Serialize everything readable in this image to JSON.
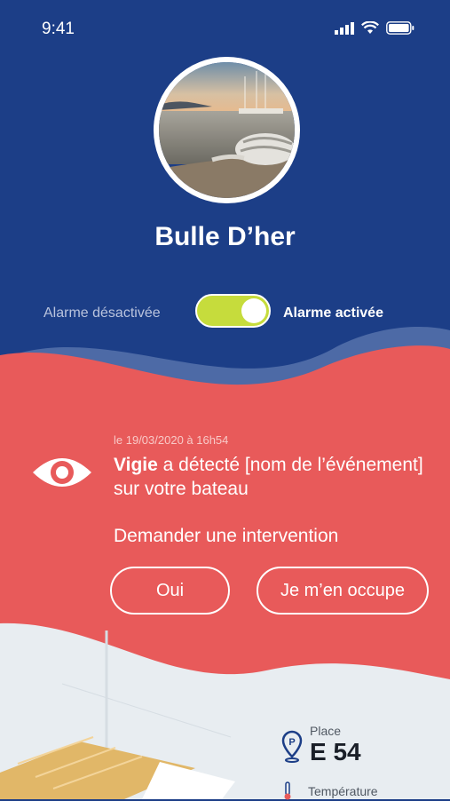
{
  "status_bar": {
    "time": "9:41"
  },
  "boat": {
    "name": "Bulle D’her"
  },
  "alarm": {
    "off_label": "Alarme désactivée",
    "on_label": "Alarme activée",
    "state": "on"
  },
  "alert": {
    "date": "le 19/03/2020 à 16h54",
    "source": "Vigie",
    "message": " a détecté [nom de l’événement] sur votre bateau",
    "question": "Demander une intervention",
    "yes_label": "Oui",
    "handle_label": "Je m’en occupe"
  },
  "info": {
    "place_label": "Place",
    "place_value": "E 54",
    "temperature_label": "Température"
  },
  "colors": {
    "navy": "#1c3e87",
    "coral": "#e85a5a",
    "toggle": "#c6dc3c",
    "light_bg": "#e8edf1"
  },
  "icons": [
    "signal-icon",
    "wifi-icon",
    "battery-icon",
    "eye-icon",
    "parking-pin-icon",
    "thermometer-icon"
  ]
}
